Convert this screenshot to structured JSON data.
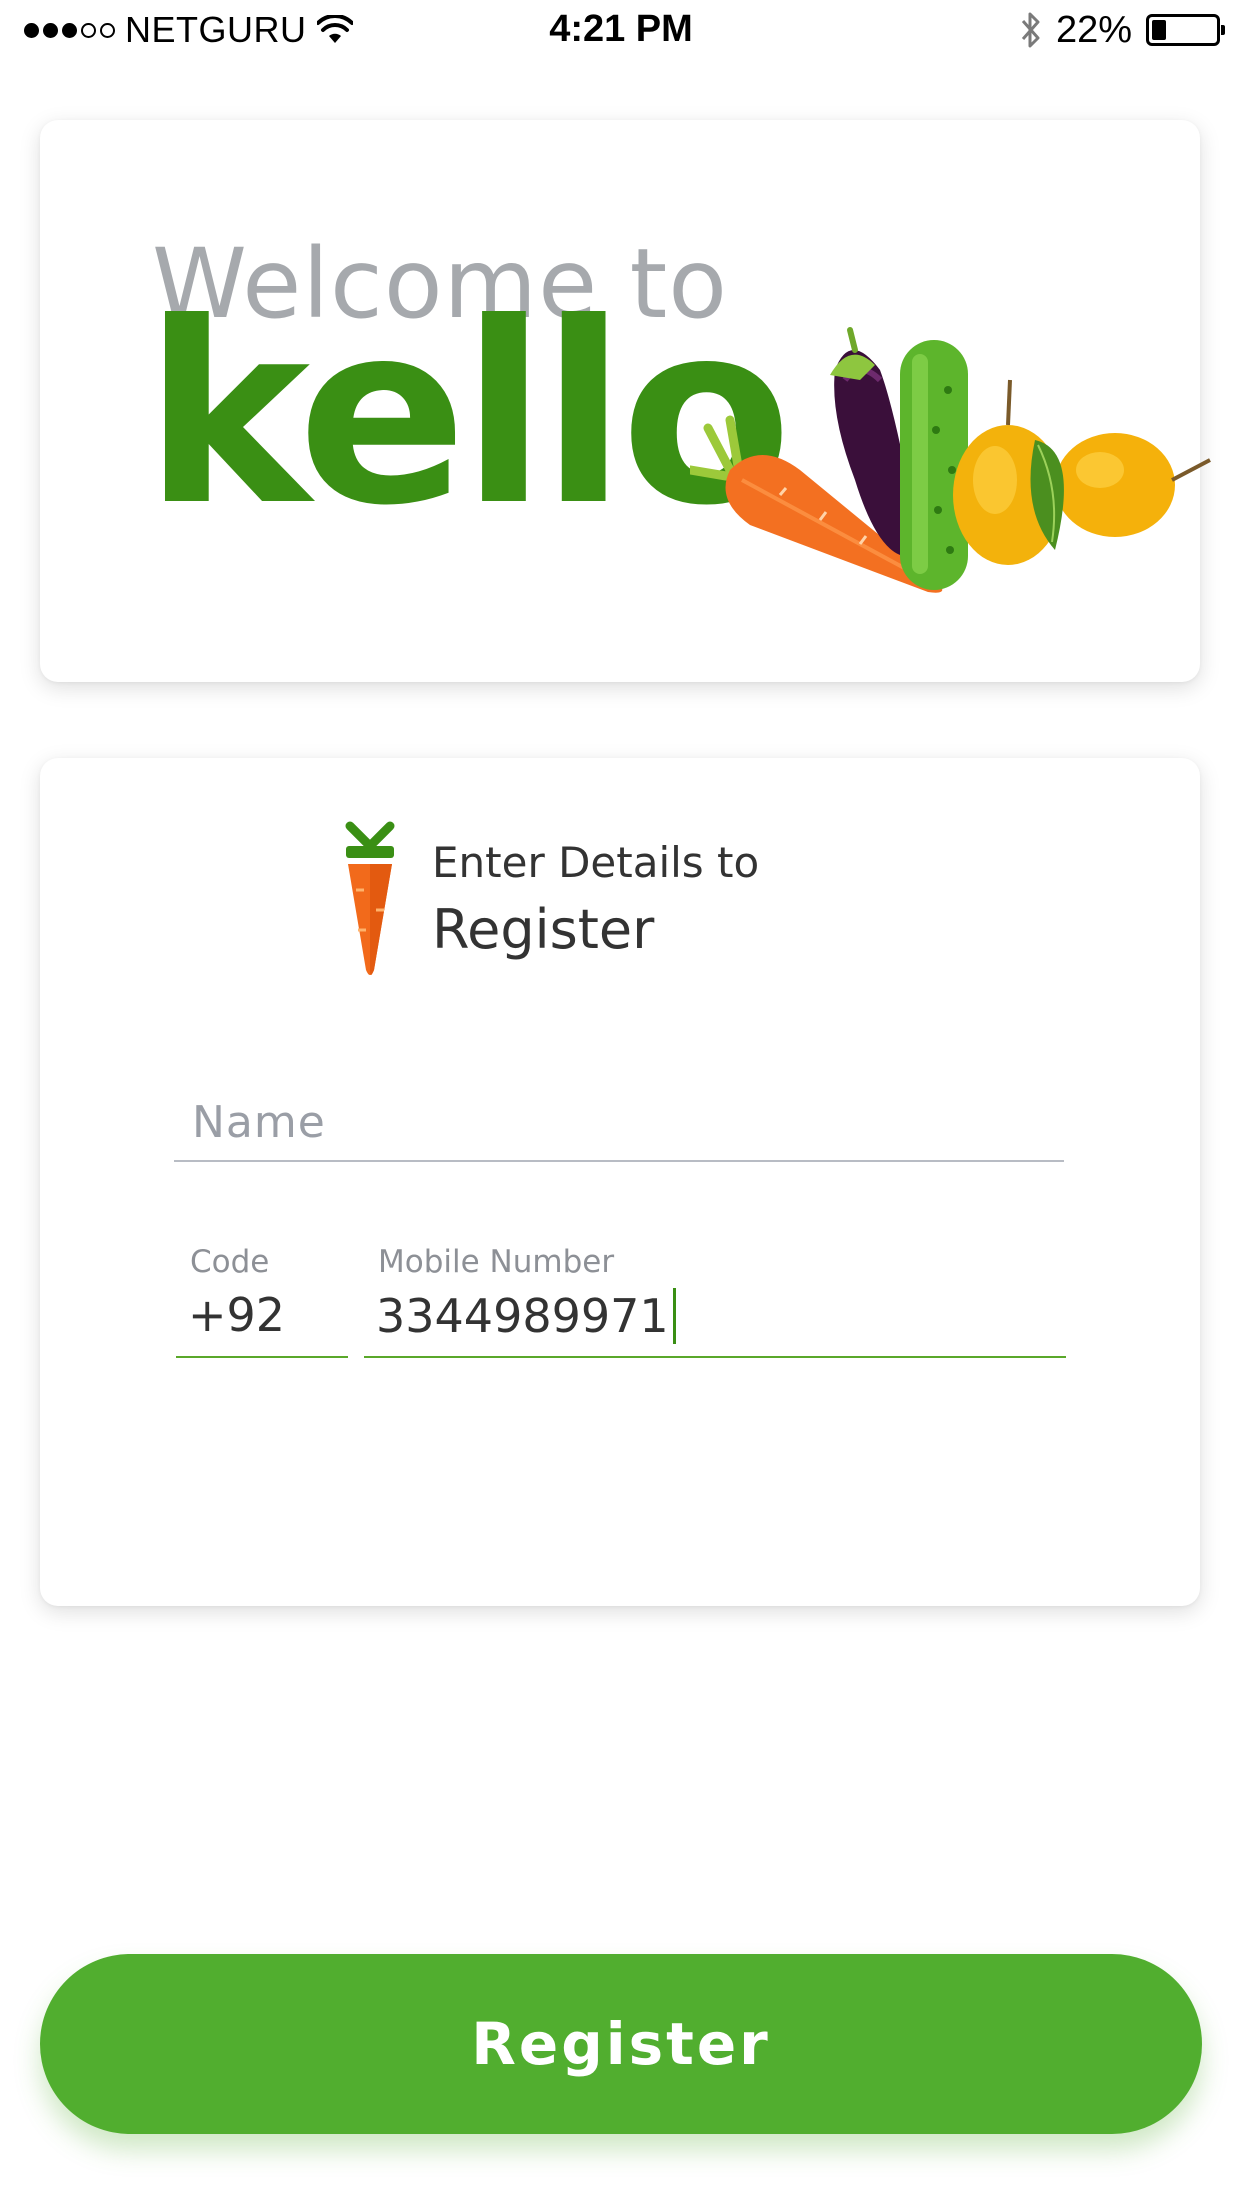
{
  "status_bar": {
    "carrier": "NETGURU",
    "time": "4:21 PM",
    "battery_percent": "22%",
    "battery_level": 0.22,
    "signal_bars_filled": 3,
    "signal_bars_total": 5,
    "icons": [
      "wifi-icon",
      "bluetooth-icon",
      "battery-icon"
    ]
  },
  "welcome": {
    "greeting": "Welcome to",
    "brand": "kello",
    "illustration": "vegetables-illustration"
  },
  "register_card": {
    "subtitle": "Enter Details to",
    "title": "Register",
    "icon": "carrot-icon"
  },
  "form": {
    "name": {
      "placeholder": "Name",
      "value": ""
    },
    "code": {
      "label": "Code",
      "value": "+92"
    },
    "mobile": {
      "label": "Mobile Number",
      "value": "3344989971"
    }
  },
  "register_button": {
    "label": "Register"
  },
  "colors": {
    "brand_green": "#3a8f14",
    "button_green": "#51ae2f",
    "welcome_gray": "#a6a9ad",
    "text_dark": "#333333"
  }
}
